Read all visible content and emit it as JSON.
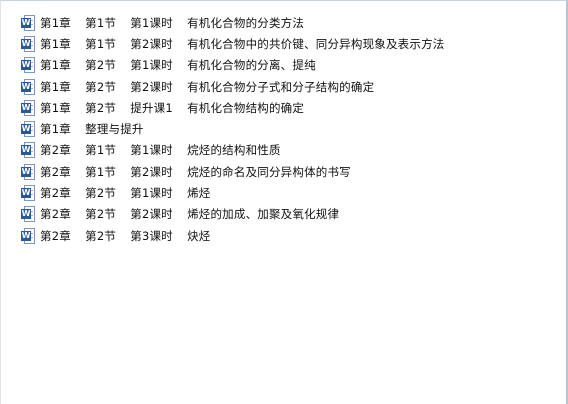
{
  "files": [
    {
      "name": "第1章  第1节  第1课时  有机化合物的分类方法",
      "icon": "word-doc-icon"
    },
    {
      "name": "第1章  第1节  第2课时  有机化合物中的共价键、同分异构现象及表示方法",
      "icon": "word-doc-icon"
    },
    {
      "name": "第1章  第2节  第1课时  有机化合物的分离、提纯",
      "icon": "word-doc-icon"
    },
    {
      "name": "第1章  第2节  第2课时  有机化合物分子式和分子结构的确定",
      "icon": "word-doc-icon"
    },
    {
      "name": "第1章  第2节  提升课1  有机化合物结构的确定",
      "icon": "word-doc-icon"
    },
    {
      "name": "第1章  整理与提升",
      "icon": "word-doc-icon"
    },
    {
      "name": "第2章  第1节  第1课时  烷烃的结构和性质",
      "icon": "word-doc-icon"
    },
    {
      "name": "第2章  第1节  第2课时  烷烃的命名及同分异构体的书写",
      "icon": "word-doc-icon"
    },
    {
      "name": "第2章  第2节  第1课时  烯烃",
      "icon": "word-doc-icon"
    },
    {
      "name": "第2章  第2节  第2课时  烯烃的加成、加聚及氧化规律",
      "icon": "word-doc-icon"
    },
    {
      "name": "第2章  第2节  第3课时  炔烃",
      "icon": "word-doc-icon"
    }
  ],
  "icon_badge_letter": "W",
  "colors": {
    "word_blue": "#2b5797",
    "text": "#111111",
    "background": "#ffffff"
  }
}
